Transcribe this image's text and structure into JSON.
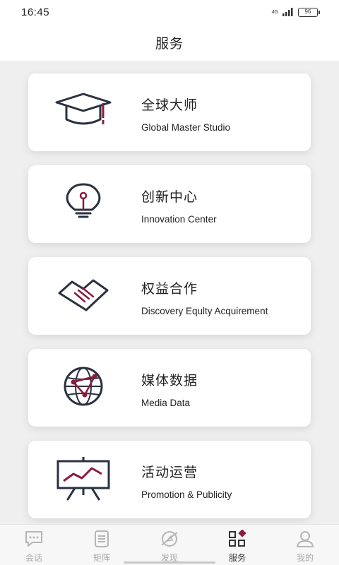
{
  "status": {
    "time": "16:45",
    "network": "4G",
    "battery": "96"
  },
  "header": {
    "title": "服务"
  },
  "colors": {
    "accent": "#8b1a3c",
    "icon_stroke": "#2a3140"
  },
  "cards": [
    {
      "title": "全球大师",
      "subtitle": "Global Master Studio",
      "icon": "graduation-cap-icon"
    },
    {
      "title": "创新中心",
      "subtitle": "Innovation Center",
      "icon": "lightbulb-icon"
    },
    {
      "title": "权益合作",
      "subtitle": "Discovery Equlty Acquirement",
      "icon": "handshake-icon"
    },
    {
      "title": "媒体数据",
      "subtitle": "Media Data",
      "icon": "globe-network-icon"
    },
    {
      "title": "活动运营",
      "subtitle": "Promotion & Publicity",
      "icon": "presentation-board-icon"
    }
  ],
  "tabs": [
    {
      "label": "会话",
      "icon": "chat-bubble-icon",
      "active": false
    },
    {
      "label": "矩阵",
      "icon": "list-doc-icon",
      "active": false
    },
    {
      "label": "发现",
      "icon": "compass-icon",
      "active": false
    },
    {
      "label": "服务",
      "icon": "grid-services-icon",
      "active": true
    },
    {
      "label": "我的",
      "icon": "profile-icon",
      "active": false
    }
  ]
}
